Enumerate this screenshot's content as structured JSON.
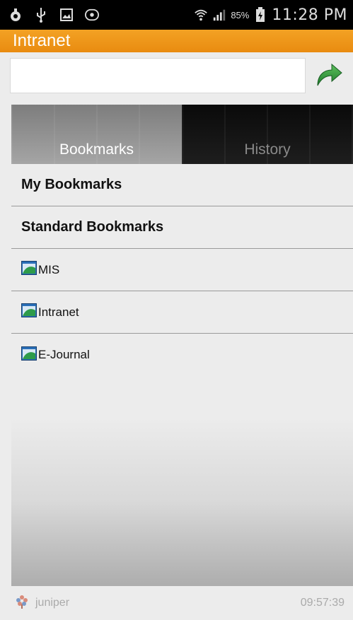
{
  "statusbar": {
    "left_icons": [
      "notification-icon",
      "usb-icon",
      "image-icon",
      "voicemail-icon"
    ],
    "battery_pct": "85%",
    "time": "11:28 PM"
  },
  "appbar": {
    "title": "Intranet"
  },
  "urlbar": {
    "value": "",
    "placeholder": ""
  },
  "tabs": [
    {
      "label": "Bookmarks",
      "selected": true
    },
    {
      "label": "History",
      "selected": false
    }
  ],
  "list": {
    "my_bookmarks": "My Bookmarks",
    "standard_bookmarks": "Standard Bookmarks",
    "items": [
      {
        "label": "MIS"
      },
      {
        "label": "Intranet"
      },
      {
        "label": "E-Journal"
      }
    ]
  },
  "footer": {
    "brand": "juniper",
    "time": "09:57:39"
  },
  "colors": {
    "appbar": "#f0961a",
    "go_arrow": "#2e8b3a"
  }
}
